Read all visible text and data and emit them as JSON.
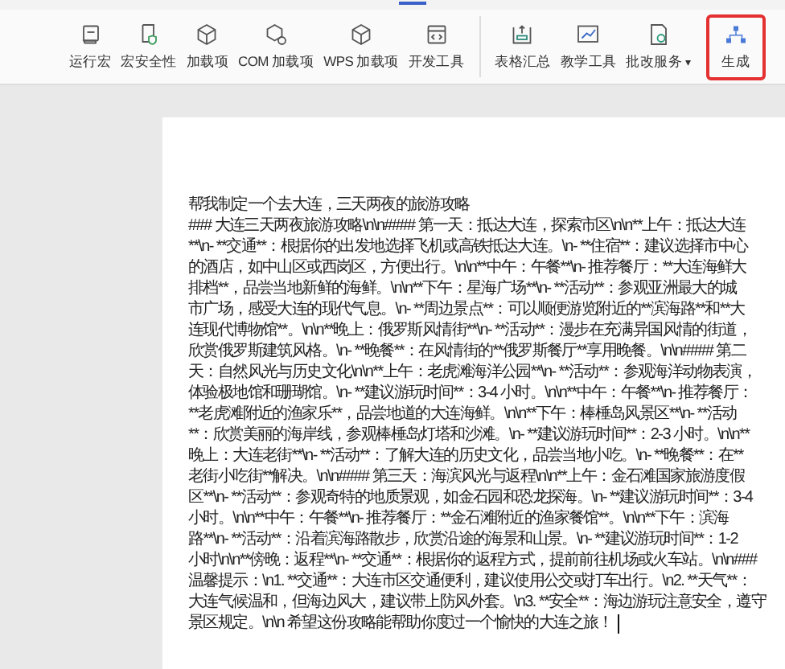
{
  "toolbar": {
    "items": [
      {
        "label": "运行宏",
        "highlighted": false
      },
      {
        "label": "宏安全性",
        "highlighted": false
      },
      {
        "label": "加载项",
        "highlighted": false
      },
      {
        "label": "COM 加载项",
        "highlighted": false
      },
      {
        "label": "WPS 加载项",
        "highlighted": false
      },
      {
        "label": "开发工具",
        "highlighted": false
      },
      {
        "label": "表格汇总",
        "highlighted": false,
        "group_start": true
      },
      {
        "label": "教学工具",
        "highlighted": false
      },
      {
        "label": "批改服务",
        "highlighted": false,
        "dropdown_caret": "▾"
      },
      {
        "label": "生成",
        "highlighted": true
      }
    ]
  },
  "document": {
    "lines": [
      "帮我制定一个去大连，三天两夜的旅游攻略",
      "### 大连三天两夜旅游攻略\\n\\n#### 第一天：抵达大连，探索市区\\n\\n**上午：抵达大连",
      "**\\n- **交通**：根据你的出发地选择飞机或高铁抵达大连。\\n- **住宿**：建议选择市中心",
      "的酒店，如中山区或西岗区，方便出行。\\n\\n**中午：午餐**\\n- 推荐餐厅：**大连海鲜大",
      "排档**，品尝当地新鲜的海鲜。\\n\\n**下午：星海广场**\\n- **活动**：参观亚洲最大的城",
      "市广场，感受大连的现代气息。\\n- **周边景点**：可以顺便游览附近的**滨海路**和**大",
      "连现代博物馆**。\\n\\n**晚上：俄罗斯风情街**\\n- **活动**：漫步在充满异国风情的街道，",
      "欣赏俄罗斯建筑风格。\\n- **晚餐**：在风情街的**俄罗斯餐厅**享用晚餐。\\n\\n#### 第二",
      "天：自然风光与历史文化\\n\\n**上午：老虎滩海洋公园**\\n- **活动**：参观海洋动物表演，",
      "体验极地馆和珊瑚馆。\\n- **建议游玩时间**：3-4 小时。\\n\\n**中午：午餐**\\n- 推荐餐厅：",
      "**老虎滩附近的渔家乐**，品尝地道的大连海鲜。\\n\\n**下午：棒棰岛风景区**\\n- **活动",
      "**：欣赏美丽的海岸线，参观棒棰岛灯塔和沙滩。\\n- **建议游玩时间**：2-3 小时。\\n\\n**",
      "晚上：大连老街**\\n- **活动**：了解大连的历史文化，品尝当地小吃。\\n- **晚餐**：在**",
      "老街小吃街**解决。\\n\\n#### 第三天：海滨风光与返程\\n\\n**上午：金石滩国家旅游度假",
      "区**\\n- **活动**：参观奇特的地质景观，如金石园和恐龙探海。\\n- **建议游玩时间**：3-4",
      "小时。\\n\\n**中午：午餐**\\n- 推荐餐厅：**金石滩附近的渔家餐馆**。\\n\\n**下午：滨海",
      "路**\\n- **活动**：沿着滨海路散步，欣赏沿途的海景和山景。\\n- **建议游玩时间**：1-2",
      "小时\\n\\n**傍晚：返程**\\n- **交通**：根据你的返程方式，提前前往机场或火车站。\\n\\n###",
      "温馨提示：\\n1. **交通**：大连市区交通便利，建议使用公交或打车出行。\\n2. **天气**：",
      "大连气候温和，但海边风大，建议带上防风外套。\\n3. **安全**：海边游玩注意安全，遵守",
      "景区规定。\\n\\n 希望这份攻略能帮助你度过一个愉快的大连之旅！"
    ]
  }
}
